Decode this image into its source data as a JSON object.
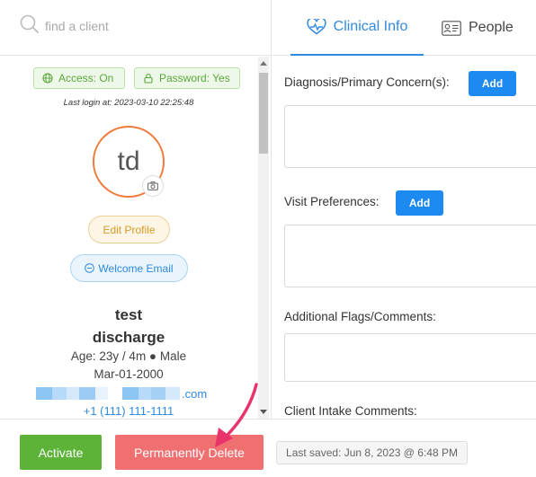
{
  "search": {
    "placeholder": "find a client"
  },
  "badges": {
    "access": "Access: On",
    "password": "Password: Yes"
  },
  "last_login": "Last login at: 2023-03-10 22:25:48",
  "avatar": {
    "initials": "td"
  },
  "buttons": {
    "edit_profile": "Edit Profile",
    "welcome_email": "Welcome Email"
  },
  "client": {
    "first_name": "test",
    "last_name": "discharge",
    "age_gender": "Age: 23y / 4m ● Male",
    "dob": "Mar-01-2000",
    "email_suffix": ".com",
    "phone": "+1 (111) 111-1111"
  },
  "tabs": [
    {
      "label": "Clinical Info",
      "icon": "heartbeat-icon",
      "active": true
    },
    {
      "label": "People",
      "icon": "contact-card-icon",
      "active": false
    }
  ],
  "clinical": {
    "diagnosis_label": "Diagnosis/Primary Concern(s):",
    "visit_label": "Visit Preferences:",
    "flags_label": "Additional Flags/Comments:",
    "intake_label": "Client Intake Comments:",
    "add_label": "Add"
  },
  "footer": {
    "activate": "Activate",
    "delete": "Permanently Delete",
    "last_saved": "Last saved: Jun 8, 2023 @ 6:48 PM"
  },
  "colors": {
    "accent": "#2f8ae0",
    "success": "#5cb338",
    "danger": "#f07071",
    "avatar_ring": "#f07a3a",
    "annotation_arrow": "#e8336b"
  }
}
